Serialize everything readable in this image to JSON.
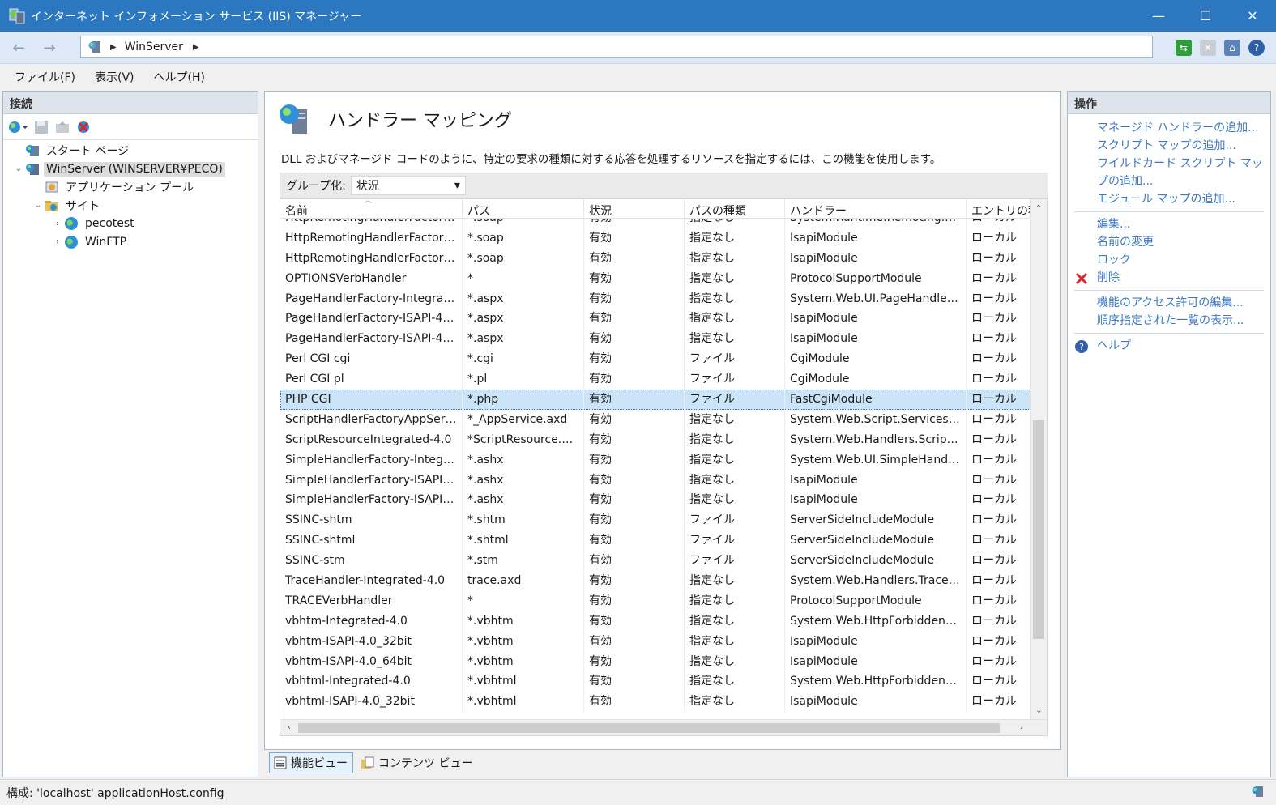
{
  "window": {
    "title": "インターネット インフォメーション サービス (IIS) マネージャー",
    "minimize": "—",
    "maximize": "☐",
    "close": "✕"
  },
  "nav": {
    "back": "←",
    "forward": "→",
    "breadcrumb": [
      "WinServer"
    ],
    "arrow": "▶"
  },
  "menu": [
    "ファイル(F)",
    "表示(V)",
    "ヘルプ(H)"
  ],
  "connections": {
    "title": "接続",
    "tree": [
      {
        "label": "スタート ページ",
        "level": 0,
        "twisty": ""
      },
      {
        "label": "WinServer (WINSERVER¥PECO)",
        "level": 0,
        "twisty": "⌄",
        "selected": true
      },
      {
        "label": "アプリケーション プール",
        "level": 1,
        "twisty": ""
      },
      {
        "label": "サイト",
        "level": 1,
        "twisty": "⌄"
      },
      {
        "label": "pecotest",
        "level": 2,
        "twisty": "›"
      },
      {
        "label": "WinFTP",
        "level": 2,
        "twisty": "›"
      }
    ]
  },
  "feature": {
    "title": "ハンドラー マッピング",
    "description": "DLL およびマネージド コードのように、特定の要求の種類に対する応答を処理するリソースを指定するには、この機能を使用します。",
    "group_label": "グループ化:",
    "group_value": "状況",
    "group_caret": "▾"
  },
  "table": {
    "columns": [
      "名前",
      "パス",
      "状況",
      "パスの種類",
      "ハンドラー",
      "エントリの種類"
    ],
    "rows": [
      [
        "HttpRemotingHandlerFactory-...",
        "*.soap",
        "有効",
        "指定なし",
        "System.Runtime.Remoting.Ch...",
        "ローカル"
      ],
      [
        "HttpRemotingHandlerFactory-...",
        "*.soap",
        "有効",
        "指定なし",
        "IsapiModule",
        "ローカル"
      ],
      [
        "HttpRemotingHandlerFactory-...",
        "*.soap",
        "有効",
        "指定なし",
        "IsapiModule",
        "ローカル"
      ],
      [
        "OPTIONSVerbHandler",
        "*",
        "有効",
        "指定なし",
        "ProtocolSupportModule",
        "ローカル"
      ],
      [
        "PageHandlerFactory-Integrate...",
        "*.aspx",
        "有効",
        "指定なし",
        "System.Web.UI.PageHandlerF...",
        "ローカル"
      ],
      [
        "PageHandlerFactory-ISAPI-4.0...",
        "*.aspx",
        "有効",
        "指定なし",
        "IsapiModule",
        "ローカル"
      ],
      [
        "PageHandlerFactory-ISAPI-4.0...",
        "*.aspx",
        "有効",
        "指定なし",
        "IsapiModule",
        "ローカル"
      ],
      [
        "Perl CGI cgi",
        "*.cgi",
        "有効",
        "ファイル",
        "CgiModule",
        "ローカル"
      ],
      [
        "Perl CGI pl",
        "*.pl",
        "有効",
        "ファイル",
        "CgiModule",
        "ローカル"
      ],
      [
        "PHP CGI",
        "*.php",
        "有効",
        "ファイル",
        "FastCgiModule",
        "ローカル"
      ],
      [
        "ScriptHandlerFactoryAppServi...",
        "*_AppService.axd",
        "有効",
        "指定なし",
        "System.Web.Script.Services.Sc...",
        "ローカル"
      ],
      [
        "ScriptResourceIntegrated-4.0",
        "*ScriptResource.axd",
        "有効",
        "指定なし",
        "System.Web.Handlers.ScriptR...",
        "ローカル"
      ],
      [
        "SimpleHandlerFactory-Integrat...",
        "*.ashx",
        "有効",
        "指定なし",
        "System.Web.UI.SimpleHandle...",
        "ローカル"
      ],
      [
        "SimpleHandlerFactory-ISAPI-4....",
        "*.ashx",
        "有効",
        "指定なし",
        "IsapiModule",
        "ローカル"
      ],
      [
        "SimpleHandlerFactory-ISAPI-4....",
        "*.ashx",
        "有効",
        "指定なし",
        "IsapiModule",
        "ローカル"
      ],
      [
        "SSINC-shtm",
        "*.shtm",
        "有効",
        "ファイル",
        "ServerSideIncludeModule",
        "ローカル"
      ],
      [
        "SSINC-shtml",
        "*.shtml",
        "有効",
        "ファイル",
        "ServerSideIncludeModule",
        "ローカル"
      ],
      [
        "SSINC-stm",
        "*.stm",
        "有効",
        "ファイル",
        "ServerSideIncludeModule",
        "ローカル"
      ],
      [
        "TraceHandler-Integrated-4.0",
        "trace.axd",
        "有効",
        "指定なし",
        "System.Web.Handlers.TraceH...",
        "ローカル"
      ],
      [
        "TRACEVerbHandler",
        "*",
        "有効",
        "指定なし",
        "ProtocolSupportModule",
        "ローカル"
      ],
      [
        "vbhtm-Integrated-4.0",
        "*.vbhtm",
        "有効",
        "指定なし",
        "System.Web.HttpForbiddenH...",
        "ローカル"
      ],
      [
        "vbhtm-ISAPI-4.0_32bit",
        "*.vbhtm",
        "有効",
        "指定なし",
        "IsapiModule",
        "ローカル"
      ],
      [
        "vbhtm-ISAPI-4.0_64bit",
        "*.vbhtm",
        "有効",
        "指定なし",
        "IsapiModule",
        "ローカル"
      ],
      [
        "vbhtml-Integrated-4.0",
        "*.vbhtml",
        "有効",
        "指定なし",
        "System.Web.HttpForbiddenH...",
        "ローカル"
      ],
      [
        "vbhtml-ISAPI-4.0_32bit",
        "*.vbhtml",
        "有効",
        "指定なし",
        "IsapiModule",
        "ローカル"
      ]
    ],
    "selected_row": 9
  },
  "views": {
    "feature": "機能ビュー",
    "content": "コンテンツ ビュー"
  },
  "actions": {
    "title": "操作",
    "groups": [
      [
        "マネージド ハンドラーの追加...",
        "スクリプト マップの追加...",
        "ワイルドカード スクリプト マップの追加...",
        "モジュール マップの追加..."
      ],
      [
        "編集...",
        "名前の変更",
        "ロック",
        "削除"
      ],
      [
        "機能のアクセス許可の編集...",
        "順序指定された一覧の表示..."
      ],
      [
        "ヘルプ"
      ]
    ]
  },
  "status": {
    "text": "構成: 'localhost' applicationHost.config"
  },
  "colors": {
    "titlebar": "#2b78c0",
    "link": "#3c78c4",
    "selected_row": "#cce4f7",
    "delete": "#d9262b"
  }
}
